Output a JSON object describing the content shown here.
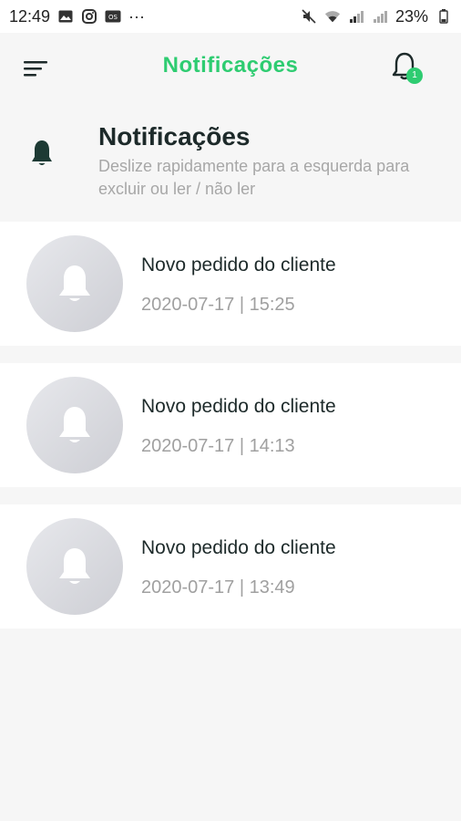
{
  "status_bar": {
    "time": "12:49",
    "more": "···",
    "battery": "23%",
    "icons": [
      "gallery-icon",
      "instagram-icon",
      "message-icon",
      "mute-icon",
      "wifi-icon",
      "signal-icon",
      "battery-icon"
    ]
  },
  "header": {
    "title": "Notificações",
    "badge_count": "1",
    "accent_color": "#2ecc71"
  },
  "intro": {
    "title": "Notificações",
    "subtitle": "Deslize rapidamente para a esquerda para excluir ou ler / não ler"
  },
  "notifications": [
    {
      "title": "Novo pedido do cliente",
      "time": "2020-07-17 | 15:25"
    },
    {
      "title": "Novo pedido do cliente",
      "time": "2020-07-17 | 14:13"
    },
    {
      "title": "Novo pedido do cliente",
      "time": "2020-07-17 | 13:49"
    }
  ]
}
